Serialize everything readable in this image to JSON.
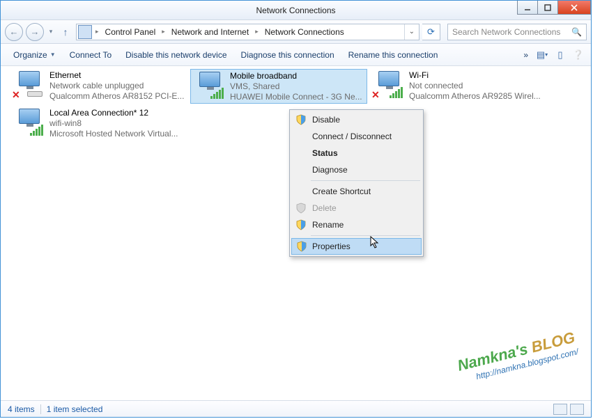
{
  "window": {
    "title": "Network Connections"
  },
  "breadcrumb": {
    "seg1": "Control Panel",
    "seg2": "Network and Internet",
    "seg3": "Network Connections"
  },
  "search": {
    "placeholder": "Search Network Connections"
  },
  "toolbar": {
    "organize": "Organize",
    "connect_to": "Connect To",
    "disable": "Disable this network device",
    "diagnose": "Diagnose this connection",
    "rename": "Rename this connection",
    "overflow": "»"
  },
  "connections": {
    "ethernet": {
      "name": "Ethernet",
      "status": "Network cable unplugged",
      "device": "Qualcomm Atheros AR8152 PCI-E..."
    },
    "mobile": {
      "name": "Mobile broadband",
      "status": "VMS, Shared",
      "device": "HUAWEI Mobile Connect - 3G Ne..."
    },
    "wifi": {
      "name": "Wi-Fi",
      "status": "Not connected",
      "device": "Qualcomm Atheros AR9285 Wirel..."
    },
    "lac": {
      "name": "Local Area Connection* 12",
      "status": "wifi-win8",
      "device": "Microsoft Hosted Network Virtual..."
    }
  },
  "context_menu": {
    "disable": "Disable",
    "connect": "Connect / Disconnect",
    "status": "Status",
    "diagnose": "Diagnose",
    "shortcut": "Create Shortcut",
    "delete": "Delete",
    "rename": "Rename",
    "properties": "Properties"
  },
  "statusbar": {
    "items": "4 items",
    "selected": "1 item selected"
  },
  "watermark": {
    "line1": "Namkna's",
    "line2": "BLOG",
    "url": "http://namkna.blogspot.com/"
  }
}
